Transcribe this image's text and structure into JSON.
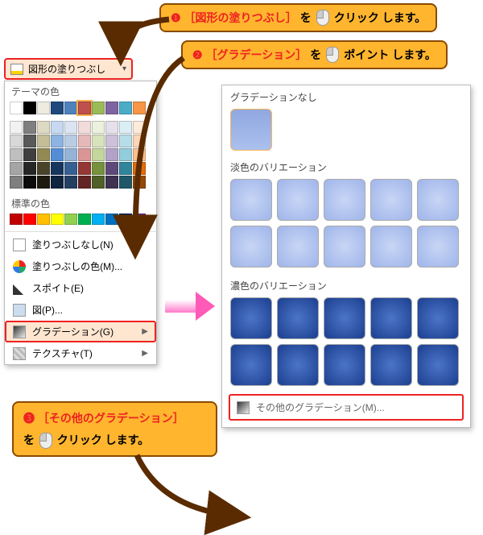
{
  "callouts": {
    "c1": {
      "num": "❶",
      "bracket": "［図形の塗りつぶし］",
      "join": "を",
      "action": "クリック",
      "tail": "します。"
    },
    "c2": {
      "num": "❷",
      "bracket": "［グラデーション］",
      "join": "を",
      "action": "ポイント",
      "tail": "します。"
    },
    "c3": {
      "num": "❸",
      "bracket": "［その他のグラデーション］",
      "join": "を",
      "action": "クリック",
      "tail": "します。"
    }
  },
  "fillButton": {
    "label": "図形の塗りつぶし"
  },
  "panel": {
    "themeHeader": "テーマの色",
    "standardHeader": "標準の色",
    "items": {
      "none": "塗りつぶしなし(N)",
      "moreColors": "塗りつぶしの色(M)...",
      "eyedrop": "スポイト(E)",
      "picture": "図(P)...",
      "gradient": "グラデーション(G)",
      "texture": "テクスチャ(T)"
    }
  },
  "flyout": {
    "noneHeader": "グラデーションなし",
    "lightHeader": "淡色のバリエーション",
    "darkHeader": "濃色のバリエーション",
    "moreGradients": "その他のグラデーション(M)..."
  },
  "themeMain": [
    "#FFFFFF",
    "#000000",
    "#EEECE1",
    "#1F497D",
    "#4F81BD",
    "#C0504D",
    "#9BBB59",
    "#8064A2",
    "#4BACC6",
    "#F79646"
  ],
  "themeShades": [
    [
      "#F2F2F2",
      "#7F7F7F",
      "#DDD9C3",
      "#C6D9F0",
      "#DBE5F1",
      "#F2DCDB",
      "#EBF1DD",
      "#E5E0EC",
      "#DBEEF3",
      "#FDEADA"
    ],
    [
      "#D8D8D8",
      "#595959",
      "#C4BD97",
      "#8DB3E2",
      "#B8CCE4",
      "#E5B9B7",
      "#D7E3BC",
      "#CCC1D9",
      "#B7DDE8",
      "#FBD5B5"
    ],
    [
      "#BFBFBF",
      "#3F3F3F",
      "#938953",
      "#548DD4",
      "#95B3D7",
      "#D99694",
      "#C3D69B",
      "#B2A2C7",
      "#92CDDC",
      "#FAC08F"
    ],
    [
      "#A5A5A5",
      "#262626",
      "#494429",
      "#17365D",
      "#366092",
      "#953734",
      "#76923C",
      "#5F497A",
      "#31859B",
      "#E36C09"
    ],
    [
      "#7F7F7F",
      "#0C0C0C",
      "#1D1B10",
      "#0F243E",
      "#244061",
      "#632423",
      "#4F6128",
      "#3F3151",
      "#205867",
      "#974806"
    ]
  ],
  "standardColors": [
    "#C00000",
    "#FF0000",
    "#FFC000",
    "#FFFF00",
    "#92D050",
    "#00B050",
    "#00B0F0",
    "#0070C0",
    "#002060",
    "#7030A0"
  ]
}
